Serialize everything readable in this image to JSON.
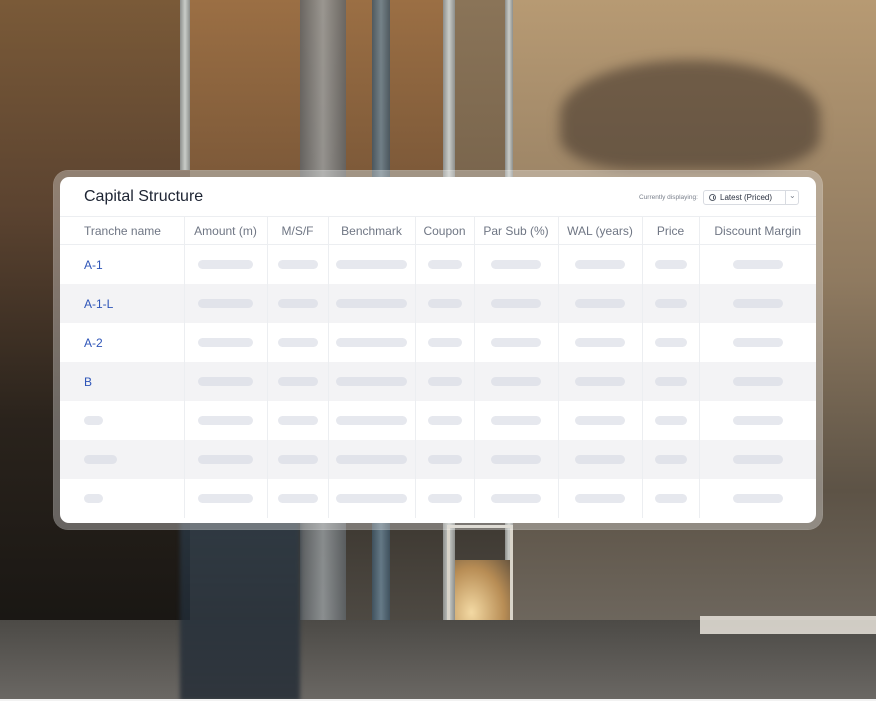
{
  "card": {
    "title": "Capital Structure",
    "display_label": "Currently displaying:",
    "display_select": {
      "value": "Latest (Priced)",
      "icon": "clock-icon"
    }
  },
  "table": {
    "columns": [
      "Tranche name",
      "Amount (m)",
      "M/S/F",
      "Benchmark",
      "Coupon",
      "Par Sub (%)",
      "WAL (years)",
      "Price",
      "Discount Margin"
    ],
    "rows": [
      {
        "tranche": "A-1"
      },
      {
        "tranche": "A-1-L"
      },
      {
        "tranche": "A-2"
      },
      {
        "tranche": "B"
      },
      {
        "tranche": ""
      },
      {
        "tranche": ""
      },
      {
        "tranche": ""
      }
    ]
  },
  "colors": {
    "accent": "#2e55b8",
    "skeleton": "#e6e8ee",
    "alt_row": "#f3f3f5"
  }
}
